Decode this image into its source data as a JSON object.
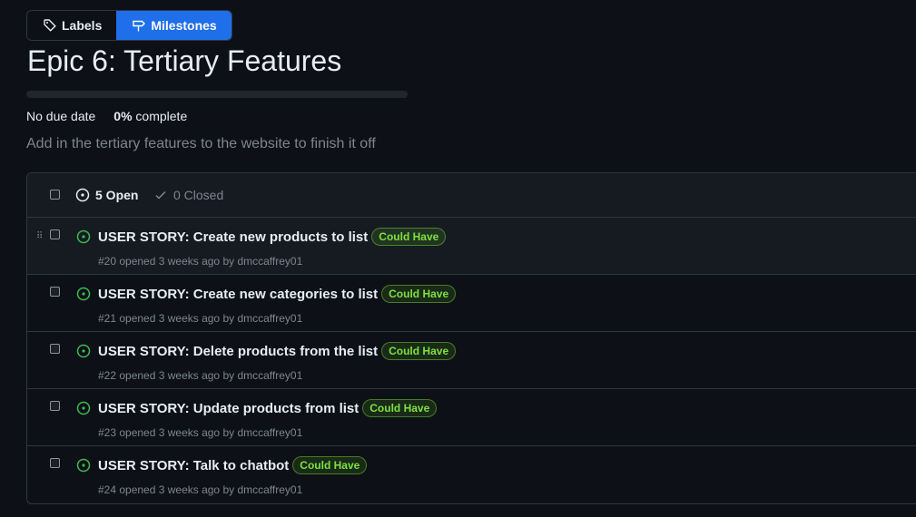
{
  "nav": {
    "labels_tab": "Labels",
    "milestones_tab": "Milestones"
  },
  "milestone": {
    "title": "Epic 6: Tertiary Features",
    "due": "No due date",
    "percent_complete": "0%",
    "complete_label": "complete",
    "progress_fraction": 0,
    "description": "Add in the tertiary features to the website to finish it off"
  },
  "issues_header": {
    "open_label": "5 Open",
    "closed_label": "0 Closed"
  },
  "issues": [
    {
      "title": "USER STORY: Create new products to list",
      "label": "Could Have",
      "meta": "#20 opened 3 weeks ago by dmccaffrey01"
    },
    {
      "title": "USER STORY: Create new categories to list",
      "label": "Could Have",
      "meta": "#21 opened 3 weeks ago by dmccaffrey01"
    },
    {
      "title": "USER STORY: Delete products from the list",
      "label": "Could Have",
      "meta": "#22 opened 3 weeks ago by dmccaffrey01"
    },
    {
      "title": "USER STORY: Update products from list",
      "label": "Could Have",
      "meta": "#23 opened 3 weeks ago by dmccaffrey01"
    },
    {
      "title": "USER STORY: Talk to chatbot",
      "label": "Could Have",
      "meta": "#24 opened 3 weeks ago by dmccaffrey01"
    }
  ],
  "icons": {
    "labels_tab": "tag-icon",
    "milestones_tab": "milestone-icon",
    "open_state": "issue-open-icon",
    "closed_state": "check-icon"
  },
  "colors": {
    "accent": "#1f6feb",
    "open_issue": "#3fb950",
    "label_text": "#7ee041"
  }
}
